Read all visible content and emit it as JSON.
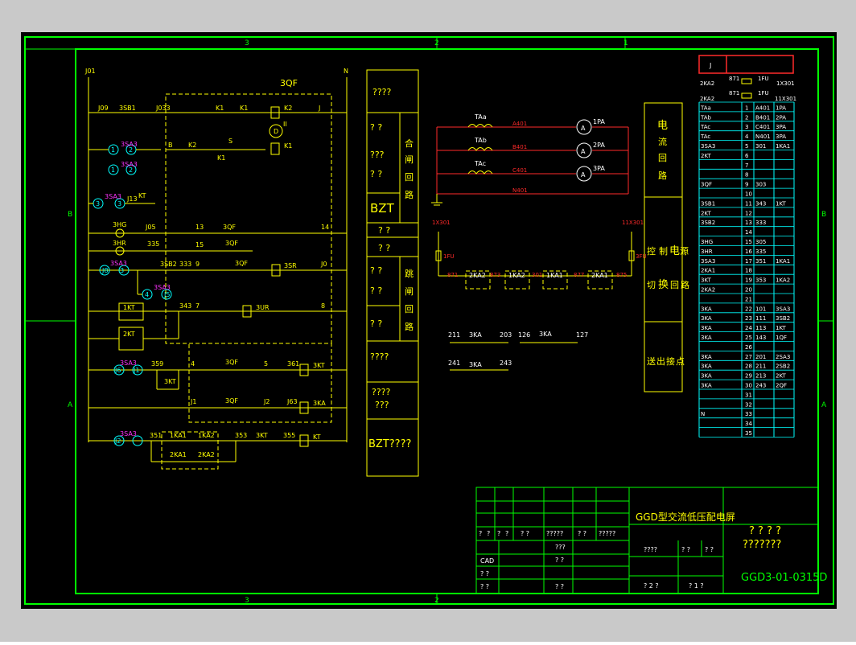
{
  "colors": {
    "background": "#000000",
    "frame": "#00ff00",
    "line": "#ffff00",
    "text": "#ffffff",
    "accent_red": "#ff2a2a",
    "accent_magenta": "#ff33ff",
    "accent_cyan": "#00ffff",
    "dashed": "#ffff00"
  },
  "border": {
    "top_zones": [
      "3",
      "2",
      "1"
    ],
    "bottom_zones": [
      "3",
      "2"
    ],
    "left_zones": [
      "B",
      "A"
    ],
    "right_zones": [
      "B",
      "A"
    ]
  },
  "control_circuit": {
    "left_bus": "J01",
    "right_bus": "N",
    "qf_label": "3QF",
    "labels": {
      "j09": "J09",
      "sb1": "3SB1",
      "j033": "J033",
      "k1a": "K1",
      "k1b": "K1",
      "k2": "K2",
      "j": "J",
      "d": "D",
      "ii": "II",
      "sa3a": "3SA3",
      "sa3b": "3SA3",
      "k2b": "K2",
      "b": "B",
      "k1c": "K1",
      "s": "S",
      "k1d": "K1",
      "sa3c": "3SA3",
      "kt1": "KT",
      "j13": "J13",
      "hg": "3HG",
      "j05": "J05",
      "n13": "13",
      "qf1": "3QF",
      "n14": "14",
      "hr": "3HR",
      "n335": "335",
      "n15": "15",
      "qf2": "3QF",
      "sa3d": "3SA3",
      "sb2": "3SB2",
      "n333": "333",
      "n9": "9",
      "qf3": "3QF",
      "sr": "3SR",
      "j10": "J0",
      "sa3e": "3SA3",
      "kt_1": "1KT",
      "n343": "343",
      "n7": "7",
      "ur": "3UR",
      "n8": "8",
      "kt_2": "2KT",
      "sa3f": "3SA3",
      "n359": "359",
      "n4": "4",
      "qf4": "3QF",
      "n5": "5",
      "n361": "361",
      "kt3": "3KT",
      "kt3b": "3KT",
      "j11": "J1",
      "qf5": "3QF",
      "j12": "J2",
      "n363": "J63",
      "ka3": "3KA",
      "sa3g": "3SA3",
      "n351": "351",
      "ka1a": "1KA1",
      "ka2a": "1KA2",
      "n353": "353",
      "kt4": "3KT",
      "n355": "355",
      "kt5": "KT",
      "ka1b": "2KA1",
      "ka2b": "2KA2"
    },
    "terminal_circles": [
      "1",
      "2",
      "1",
      "2",
      "3",
      "3",
      "J8",
      "3",
      "4",
      "J5",
      "J6",
      "J1",
      "J2"
    ]
  },
  "function_column": {
    "rows": [
      {
        "left": "????",
        "right": ""
      },
      {
        "left": "?  ?",
        "right": "合"
      },
      {
        "left": "???",
        "right": "闸"
      },
      {
        "left": "?  ?",
        "right": "回"
      },
      {
        "left": "BZT",
        "right": "路"
      },
      {
        "left": "?    ?",
        "right": ""
      },
      {
        "left": "?    ?",
        "right": ""
      },
      {
        "left": "?  ?",
        "right": "跳"
      },
      {
        "left": "?  ?",
        "right": "闸"
      },
      {
        "left": "?  ?",
        "right": "回"
      },
      {
        "left": "?  ?",
        "right": "路"
      },
      {
        "left": "????",
        "right": ""
      },
      {
        "left": "????",
        "right": ""
      },
      {
        "left": "???",
        "right": ""
      },
      {
        "left": "BZT????",
        "right": ""
      }
    ]
  },
  "current_circuit": {
    "ct_labels": [
      "TAa",
      "TAb",
      "TAc"
    ],
    "wire_labels": [
      "A401",
      "B401",
      "C401",
      "N401"
    ],
    "ammeters": [
      {
        "symbol": "A",
        "label": "1PA"
      },
      {
        "symbol": "A",
        "label": "2PA"
      },
      {
        "symbol": "A",
        "label": "3PA"
      }
    ]
  },
  "relay_circuit": {
    "left_terminal": "1X301",
    "right_terminal": "11X301",
    "fuse_left": "1FU",
    "fuse_right": "3FU",
    "nodes": [
      "871",
      "873",
      "301",
      "877",
      "875"
    ],
    "coils": [
      "2KA2",
      "1KA2",
      "1KA1",
      "2KA1"
    ],
    "contacts": [
      {
        "a": "211",
        "name": "3KA",
        "b": "203"
      },
      {
        "a": "126",
        "name": "3KA",
        "b": "127"
      },
      {
        "a": "241",
        "name": "3KA",
        "b": "243"
      }
    ]
  },
  "loop_names": {
    "current": [
      "电",
      "流",
      "回",
      "路"
    ],
    "control_left": [
      "控",
      "制",
      "电",
      "源"
    ],
    "control_right": [
      "切",
      "换",
      "回",
      "路"
    ],
    "signal": [
      "送",
      "出",
      "接",
      "点"
    ]
  },
  "terminal_block": {
    "header_left": "J",
    "header_right": "",
    "top_rows": [
      {
        "label": "2KA2",
        "wire": "871",
        "fuse": "1FU",
        "dest": "1X301"
      },
      {
        "label": "2KA2",
        "wire": "871",
        "fuse": "1FU",
        "dest": "11X301"
      }
    ],
    "rows": [
      {
        "label": "TAa",
        "n": "1",
        "a": "A401",
        "b": "1PA"
      },
      {
        "label": "TAb",
        "n": "2",
        "a": "B401",
        "b": "2PA"
      },
      {
        "label": "TAc",
        "n": "3",
        "a": "C401",
        "b": "3PA"
      },
      {
        "label": "TAc",
        "n": "4",
        "a": "N401",
        "b": "3PA"
      },
      {
        "label": "3SA3",
        "n": "5",
        "a": "301",
        "b": "1KA1"
      },
      {
        "label": "2KT",
        "n": "6",
        "a": "",
        "b": ""
      },
      {
        "label": "",
        "n": "7",
        "a": "",
        "b": ""
      },
      {
        "label": "",
        "n": "8",
        "a": "",
        "b": ""
      },
      {
        "label": "3QF",
        "n": "9",
        "a": "303",
        "b": ""
      },
      {
        "label": "",
        "n": "10",
        "a": "",
        "b": ""
      },
      {
        "label": "3SB1",
        "n": "11",
        "a": "343",
        "b": "1KT"
      },
      {
        "label": "2KT",
        "n": "12",
        "a": "",
        "b": ""
      },
      {
        "label": "3SB2",
        "n": "13",
        "a": "333",
        "b": ""
      },
      {
        "label": "",
        "n": "14",
        "a": "",
        "b": ""
      },
      {
        "label": "3HG",
        "n": "15",
        "a": "305",
        "b": ""
      },
      {
        "label": "3HR",
        "n": "16",
        "a": "335",
        "b": ""
      },
      {
        "label": "3SA3",
        "n": "17",
        "a": "351",
        "b": "1KA1"
      },
      {
        "label": "2KA1",
        "n": "18",
        "a": "",
        "b": ""
      },
      {
        "label": "3KT",
        "n": "19",
        "a": "353",
        "b": "1KA2"
      },
      {
        "label": "2KA2",
        "n": "20",
        "a": "",
        "b": ""
      },
      {
        "label": "",
        "n": "21",
        "a": "",
        "b": ""
      },
      {
        "label": "3KA",
        "n": "22",
        "a": "101",
        "b": "3SA3"
      },
      {
        "label": "3KA",
        "n": "23",
        "a": "111",
        "b": "3SB2"
      },
      {
        "label": "3KA",
        "n": "24",
        "a": "113",
        "b": "1KT"
      },
      {
        "label": "3KA",
        "n": "25",
        "a": "143",
        "b": "1QF"
      },
      {
        "label": "",
        "n": "26",
        "a": "",
        "b": ""
      },
      {
        "label": "3KA",
        "n": "27",
        "a": "201",
        "b": "2SA3"
      },
      {
        "label": "3KA",
        "n": "28",
        "a": "211",
        "b": "2SB2"
      },
      {
        "label": "3KA",
        "n": "29",
        "a": "213",
        "b": "2KT"
      },
      {
        "label": "3KA",
        "n": "30",
        "a": "243",
        "b": "2QF"
      },
      {
        "label": "",
        "n": "31",
        "a": "",
        "b": ""
      },
      {
        "label": "",
        "n": "32",
        "a": "",
        "b": ""
      },
      {
        "label": "N",
        "n": "33",
        "a": "",
        "b": ""
      },
      {
        "label": "",
        "n": "34",
        "a": "",
        "b": ""
      },
      {
        "label": "",
        "n": "35",
        "a": "",
        "b": ""
      }
    ]
  },
  "title_block": {
    "product": "GGD型交流低压配电屏",
    "subtitle_1": "? ? ? ?",
    "subtitle_2": "???????",
    "drawing_no": "GGD3-01-0315D",
    "row1": [
      "?",
      "?",
      "?",
      "?",
      "?  ?",
      "?????",
      "?  ?",
      "?????"
    ],
    "cad": "CAD",
    "q1": "???",
    "q2": "?  ?",
    "q3": "?  ?",
    "q4": "?  ?",
    "q5": "?  ?",
    "scale_label": "????",
    "s1": "?  ?",
    "s2": "?  ?",
    "sheet_total": "?  2  ?",
    "sheet_no": "?  1  ?"
  }
}
